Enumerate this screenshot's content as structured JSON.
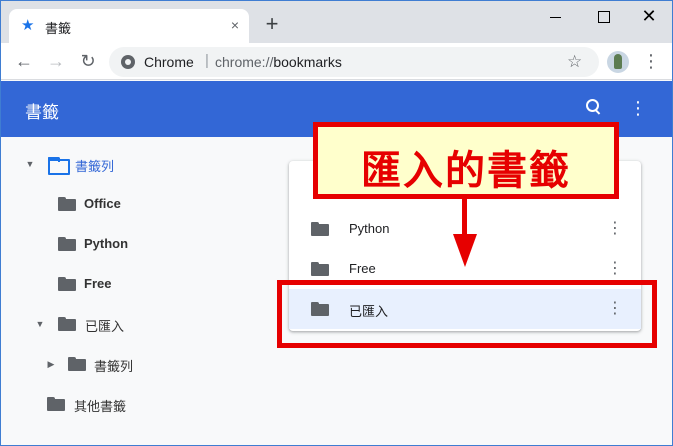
{
  "tab": {
    "title": "書籤",
    "close": "×",
    "favicon": "star-icon"
  },
  "new_tab": "+",
  "window_controls": {
    "close": "✕"
  },
  "omnibox": {
    "site": "Chrome",
    "separator": "|",
    "scheme": "chrome://",
    "path": "bookmarks"
  },
  "appbar": {
    "title": "書籤",
    "menu": "⋮"
  },
  "tree": {
    "bookmarks_bar": "書籤列",
    "office": "Office",
    "python": "Python",
    "free": "Free",
    "imported": "已匯入",
    "imported_bar": "書籤列",
    "other": "其他書籤"
  },
  "list": [
    {
      "label": "Python",
      "menu": "⋮"
    },
    {
      "label": "Free",
      "menu": "⋮"
    },
    {
      "label": "已匯入",
      "menu": "⋮"
    }
  ],
  "annotation": {
    "text": "匯入的書籤",
    "color": "#e60000"
  },
  "colors": {
    "accent": "#3367d6",
    "selected_row": "#e8f0fe"
  }
}
